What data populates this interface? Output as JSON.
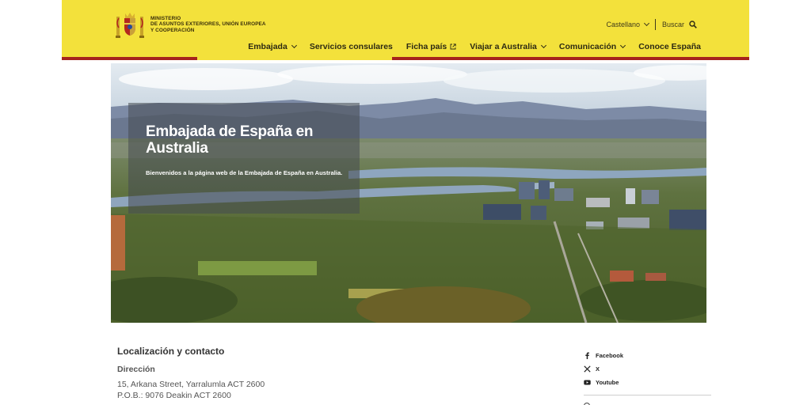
{
  "header": {
    "ministry_lines": [
      "Ministerio",
      "de Asuntos Exteriores, Unión Europea",
      "y Cooperación"
    ],
    "language": "Castellano",
    "search_label": "Buscar",
    "colors": {
      "yellow": "#f3e13b",
      "red": "#a5241d"
    }
  },
  "nav": {
    "items": [
      {
        "label": "Embajada",
        "icon": "chevron-down-icon"
      },
      {
        "label": "Servicios consulares",
        "icon": ""
      },
      {
        "label": "Ficha país",
        "icon": "external-link-icon"
      },
      {
        "label": "Viajar a Australia",
        "icon": "chevron-down-icon"
      },
      {
        "label": "Comunicación",
        "icon": "chevron-down-icon"
      },
      {
        "label": "Conoce España",
        "icon": ""
      }
    ]
  },
  "hero": {
    "title": "Embajada de España en Australia",
    "subtitle": "Bienvenidos a la página web de la Embajada de España en Australia."
  },
  "contact": {
    "section_title": "Localización y contacto",
    "address_title": "Dirección",
    "address_lines": [
      "15, Arkana Street, Yarralumla ACT 2600",
      "P.O.B.: 9076 Deakin ACT 2600"
    ]
  },
  "social": {
    "items": [
      {
        "label": "Facebook",
        "icon": "facebook-icon"
      },
      {
        "label": "X",
        "icon": "x-icon"
      },
      {
        "label": "Youtube",
        "icon": "youtube-icon"
      }
    ]
  }
}
